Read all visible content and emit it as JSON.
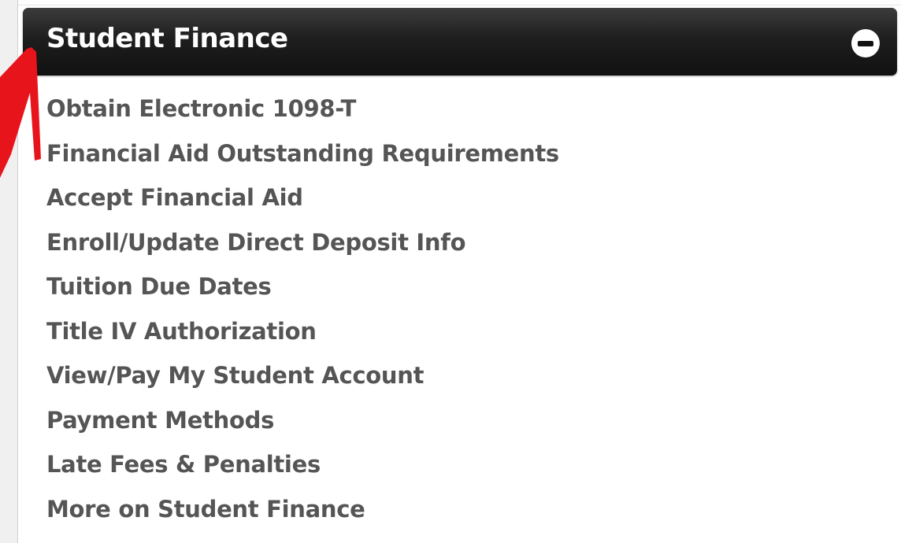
{
  "panel": {
    "title": "Student Finance",
    "collapse_icon": "minus-circle-icon",
    "links": [
      {
        "label": "Obtain Electronic 1098-T"
      },
      {
        "label": "Financial Aid Outstanding Requirements"
      },
      {
        "label": "Accept Financial Aid"
      },
      {
        "label": "Enroll/Update Direct Deposit Info"
      },
      {
        "label": "Tuition Due Dates"
      },
      {
        "label": "Title IV Authorization"
      },
      {
        "label": "View/Pay My Student Account"
      },
      {
        "label": "Payment Methods"
      },
      {
        "label": "Late Fees & Penalties"
      },
      {
        "label": "More on Student Finance"
      }
    ]
  },
  "annotation": {
    "icon": "red-arrow-icon",
    "color": "#e8141c"
  },
  "colors": {
    "header_bg": "#1e1e1e",
    "header_text": "#ffffff",
    "link_text": "#555555"
  }
}
